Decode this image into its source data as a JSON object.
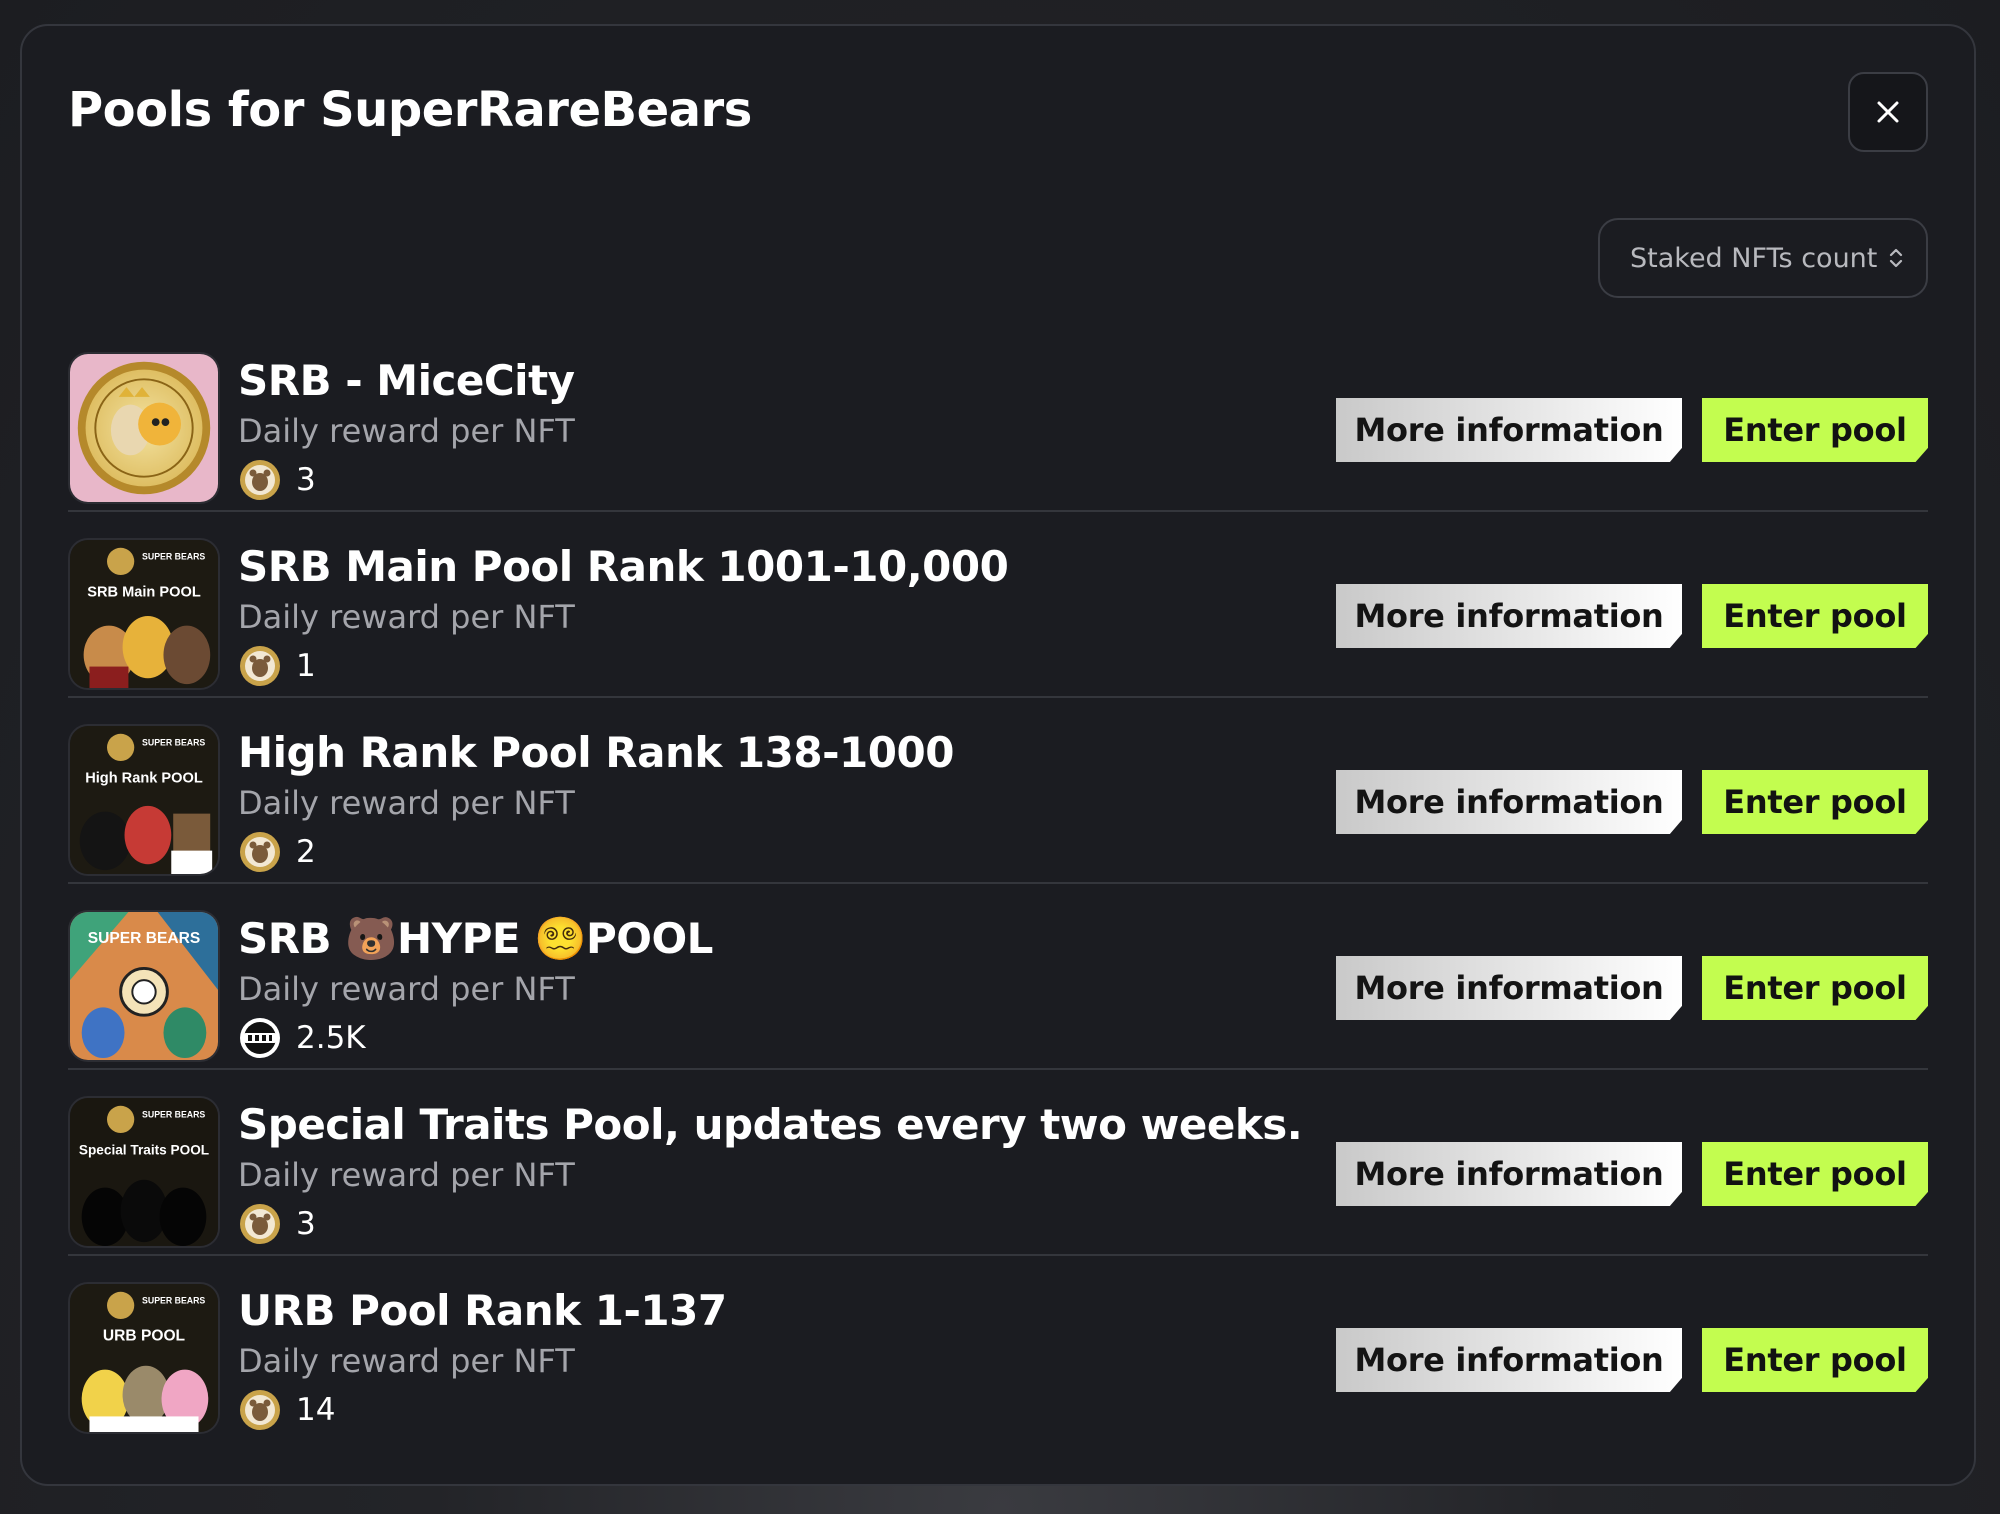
{
  "modal": {
    "title": "Pools for SuperRareBears",
    "close_icon": "close-icon",
    "sort": {
      "selected": "Staked NFTs count",
      "icon": "chevron-up-down-icon"
    }
  },
  "colors": {
    "modal_bg": "#1b1c21",
    "accent_green": "#c3fd4f",
    "text_muted": "#a4a5ab"
  },
  "pools": [
    {
      "name": "SRB - MiceCity",
      "reward_label": "Daily reward per NFT",
      "reward_value": "3",
      "token_icon": "bear-coin-icon",
      "more_info_label": "More information",
      "enter_label": "Enter pool"
    },
    {
      "name": "SRB Main Pool Rank 1001-10,000",
      "reward_label": "Daily reward per NFT",
      "reward_value": "1",
      "token_icon": "bear-coin-icon",
      "thumb_brand": "SUPER BEARS",
      "thumb_caption": "SRB Main POOL",
      "more_info_label": "More information",
      "enter_label": "Enter pool"
    },
    {
      "name": "High Rank Pool Rank 138-1000",
      "reward_label": "Daily reward per NFT",
      "reward_value": "2",
      "token_icon": "bear-coin-icon",
      "thumb_brand": "SUPER BEARS",
      "thumb_caption": "High Rank POOL",
      "more_info_label": "More information",
      "enter_label": "Enter pool"
    },
    {
      "name": "SRB 🐻HYPE 😵‍💫POOL",
      "reward_label": "Daily reward per NFT",
      "reward_value": "2.5K",
      "token_icon": "hype-token-icon",
      "thumb_brand": "SUPER BEARS",
      "more_info_label": "More information",
      "enter_label": "Enter pool"
    },
    {
      "name": "Special Traits Pool, updates every two weeks.",
      "reward_label": "Daily reward per NFT",
      "reward_value": "3",
      "token_icon": "bear-coin-icon",
      "thumb_brand": "SUPER BEARS",
      "thumb_caption": "Special Traits POOL",
      "more_info_label": "More information",
      "enter_label": "Enter pool"
    },
    {
      "name": "URB Pool Rank 1-137",
      "reward_label": "Daily reward per NFT",
      "reward_value": "14",
      "token_icon": "bear-coin-icon",
      "thumb_brand": "SUPER BEARS",
      "thumb_caption": "URB POOL",
      "more_info_label": "More information",
      "enter_label": "Enter pool"
    }
  ]
}
